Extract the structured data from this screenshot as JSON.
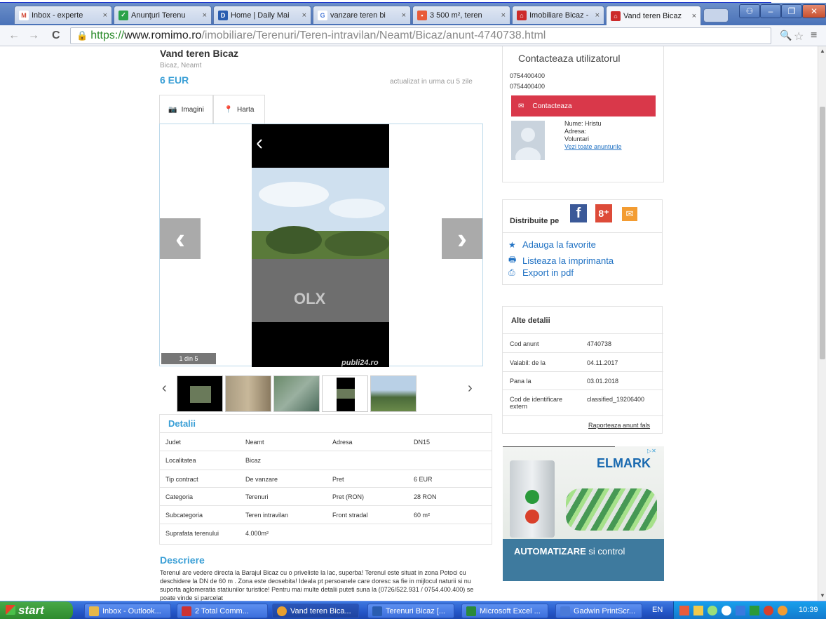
{
  "browser": {
    "tabs": [
      {
        "label": "Inbox - experte",
        "favicon": "gmail-icon",
        "color": "#d14836"
      },
      {
        "label": "Anunţuri Terenu",
        "favicon": "check-icon",
        "color": "#2aa24a"
      },
      {
        "label": "Home | Daily Mai",
        "favicon": "dm-icon",
        "color": "#2a5db0"
      },
      {
        "label": "vanzare teren bi",
        "favicon": "google-icon",
        "color": "#4a7ad8"
      },
      {
        "label": "3 500 m², teren",
        "favicon": "olx-icon",
        "color": "#e85c3a"
      },
      {
        "label": "Imobiliare Bicaz -",
        "favicon": "home-icon",
        "color": "#cc2a2a"
      },
      {
        "label": "Vand teren Bicaz",
        "favicon": "home-icon",
        "color": "#cc2a2a"
      }
    ],
    "tab_close": "×",
    "url": {
      "scheme": "https://",
      "host": "www.romimo.ro",
      "path": "/imobiliare/Terenuri/Teren-intravilan/Neamt/Bicaz/anunt-4740738.html"
    }
  },
  "listing": {
    "title": "Vand teren Bicaz",
    "location": "Bicaz, Neamt",
    "price": "6 EUR",
    "updated": "actualizat in urma cu 5 zile",
    "view_tabs": [
      "Imagini",
      "Harta"
    ],
    "photo_counter": "1 din 5",
    "photo_watermark": "OLX",
    "photo_source": "publi24.ro",
    "details_header": "Detalii",
    "details_left": [
      {
        "label": "Judet",
        "value": "Neamt"
      },
      {
        "label": "Localitatea",
        "value": "Bicaz"
      },
      {
        "label": "Tip contract",
        "value": "De vanzare"
      },
      {
        "label": "Categoria",
        "value": "Terenuri"
      },
      {
        "label": "Subcategoria",
        "value": "Teren intravilan"
      },
      {
        "label": "Suprafata terenului",
        "value": "4.000m²"
      }
    ],
    "details_right": [
      {
        "label": "Adresa",
        "value": "DN15"
      },
      {
        "label": "Pret",
        "value": "6 EUR"
      },
      {
        "label": "Pret (RON)",
        "value": "28 RON"
      },
      {
        "label": "Front stradal",
        "value": "60 m²"
      }
    ],
    "description_header": "Descriere",
    "description": "Terenul are vedere directa la Barajul Bicaz cu o priveliste la lac, superba! Terenul este situat in zona Potoci cu deschidere la DN de 60 m . Zona este deosebita! Ideala pt persoanele care doresc sa fie in mijlocul naturii si nu suporta aglomeratia statiunilor turistice! Pentru mai multe detalii puteti suna la (0726/522.931 / 0754.400.400) se poate vinde si parcelat"
  },
  "contact": {
    "title": "Contacteaza utilizatorul",
    "phone1": "0754400400",
    "phone2": "0754400400",
    "button": "Contacteaza",
    "name": "Nume: Hristu",
    "address_label": "Adresa:",
    "address_value": "Voluntari",
    "all_ads": "Vezi toate anunturile"
  },
  "share": {
    "label": "Distribuite pe",
    "favorite": "Adauga la favorite",
    "print": "Listeaza la imprimanta",
    "pdf": "Export in pdf"
  },
  "other": {
    "title": "Alte detalii",
    "rows": [
      {
        "label": "Cod anunt",
        "value": "4740738"
      },
      {
        "label": "Valabil: de la",
        "value": "04.11.2017"
      },
      {
        "label": "Pana la",
        "value": "03.01.2018"
      },
      {
        "label": "Cod de identificare extern",
        "value": "classified_19206400"
      }
    ],
    "report": "Raporteaza anunt fals"
  },
  "ad": {
    "brand": "ELMARK",
    "bold": "AUTOMATIZARE",
    "rest": " si control"
  },
  "taskbar": {
    "start": "start",
    "tasks": [
      {
        "label": "Inbox - Outlook...",
        "color": "#e8b84a"
      },
      {
        "label": "2 Total Comm...",
        "color": "#cc3333"
      },
      {
        "label": "Vand teren Bica...",
        "color": "#e8a030"
      },
      {
        "label": "Terenuri Bicaz [...",
        "color": "#2a5db0"
      },
      {
        "label": "Microsoft Excel ...",
        "color": "#2a8a3a"
      },
      {
        "label": "Gadwin PrintScr...",
        "color": "#4a7ad8"
      }
    ],
    "lang": "EN",
    "clock": "10:39"
  }
}
